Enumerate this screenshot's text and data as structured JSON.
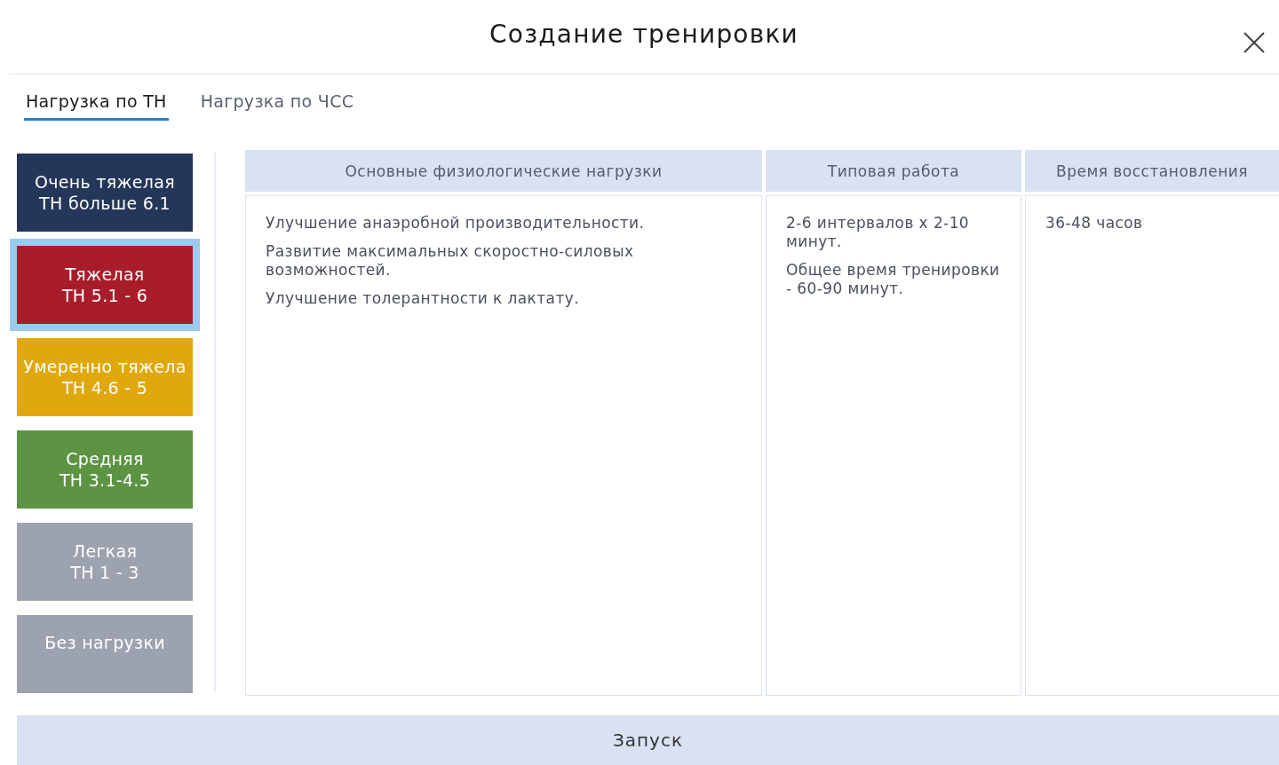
{
  "window": {
    "title": "Создание тренировки"
  },
  "tabs": [
    {
      "label": "Нагрузка по ТН",
      "selected": true
    },
    {
      "label": "Нагрузка по ЧСС",
      "selected": false
    }
  ],
  "levels": [
    {
      "name": "Очень тяжелая",
      "range": "ТН больше 6.1",
      "color": "#243659",
      "selected": false
    },
    {
      "name": "Тяжелая",
      "range": "ТН 5.1 - 6",
      "color": "#a91d2a",
      "selected": true
    },
    {
      "name": "Умеренно тяжела",
      "range": "ТН 4.6 - 5",
      "color": "#e0a80c",
      "selected": false
    },
    {
      "name": "Средняя",
      "range": "ТН 3.1-4.5",
      "color": "#5c9444",
      "selected": false
    },
    {
      "name": "Легкая",
      "range": "ТН 1 - 3",
      "color": "#9ca2ae",
      "selected": false
    },
    {
      "name": "Без нагрузки",
      "color": "#9ca2ae",
      "selected": false
    }
  ],
  "table": {
    "columns": [
      "Основные физиологические нагрузки",
      "Типовая работа",
      "Время восстановления"
    ],
    "rows": [
      [
        [
          "Улучшение анаэробной производительности.",
          "Развитие максимальных скоростно-силовых возможностей.",
          "Улучшение толерантности к лактату."
        ],
        [
          "2-6 интервалов х 2-10 минут.",
          "Общее время тренировки - 60-90 минут."
        ],
        [
          "36-48 часов"
        ]
      ]
    ]
  },
  "buttons": [
    "Запуск"
  ]
}
